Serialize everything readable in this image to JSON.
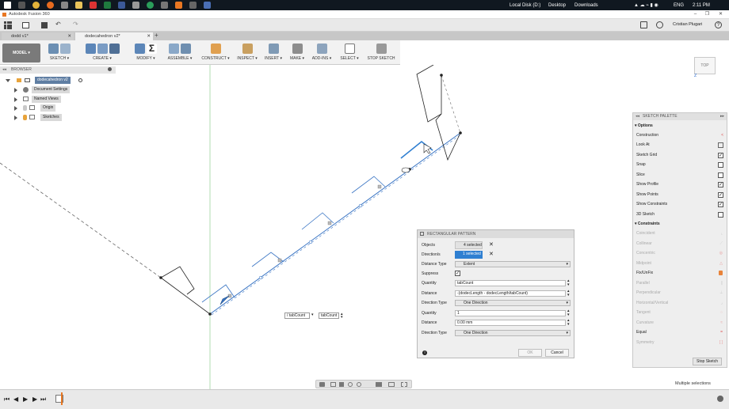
{
  "window": {
    "title": "Autodesk Fusion 360",
    "controls": [
      "–",
      "❐",
      "✕"
    ]
  },
  "taskbar": {
    "drive": "Local Disk (D:)",
    "desktop": "Desktop",
    "downloads": "Downloads",
    "lang": "ENG",
    "time": "2:11 PM"
  },
  "appbar": {
    "user": "Cristian Plugari"
  },
  "tabs": [
    {
      "label": "dodd v1*"
    },
    {
      "label": "dodecahedron v2*"
    }
  ],
  "toolbar": {
    "mode": "MODEL",
    "groups": [
      "SKETCH",
      "CREATE",
      "MODIFY",
      "ASSEMBLE",
      "CONSTRUCT",
      "INSPECT",
      "INSERT",
      "MAKE",
      "ADD-INS",
      "SELECT",
      "STOP SKETCH"
    ]
  },
  "browser": {
    "header": "BROWSER",
    "root": "dodecahedron v2",
    "items": [
      "Document Settings",
      "Named Views",
      "Origin",
      "Sketches"
    ]
  },
  "viewcube": {
    "face": "TOP",
    "axis": "Z"
  },
  "palette": {
    "title": "SKETCH PALETTE",
    "options_header": "Options",
    "options": [
      {
        "label": "Construction",
        "type": "icon",
        "icon": "construction-icon"
      },
      {
        "label": "Look At",
        "type": "icon",
        "icon": "look-at-icon"
      },
      {
        "label": "Sketch Grid",
        "type": "check",
        "checked": true
      },
      {
        "label": "Snap",
        "type": "check",
        "checked": false
      },
      {
        "label": "Slice",
        "type": "check",
        "checked": false
      },
      {
        "label": "Show Profile",
        "type": "check",
        "checked": true
      },
      {
        "label": "Show Points",
        "type": "check",
        "checked": true
      },
      {
        "label": "Show Constraints",
        "type": "check",
        "checked": true
      },
      {
        "label": "3D Sketch",
        "type": "check",
        "checked": false
      }
    ],
    "constraints_header": "Constraints",
    "constraints": [
      "Coincident",
      "Collinear",
      "Concentric",
      "Midpoint",
      "Fix/UnFix",
      "Parallel",
      "Perpendicular",
      "Horizontal/Vertical",
      "Tangent",
      "Curvature",
      "Equal",
      "Symmetry"
    ],
    "stop_button": "Stop Sketch",
    "status": "Multiple selections"
  },
  "dialog": {
    "title": "RECTANGULAR PATTERN",
    "objects_label": "Objects",
    "objects_value": "4 selected",
    "directions_label": "Direction/s",
    "directions_value": "1 selected",
    "distance_type_label": "Distance Type",
    "distance_type_value": "Extent",
    "suppress_label": "Suppress",
    "quantity1_label": "Quantity",
    "quantity1_value": "tabCount",
    "distance1_label": "Distance",
    "distance1_value": "-(dodecLength - dodecLength/tabCount)",
    "direction_type1_label": "Direction Type",
    "direction_type1_value": "One Direction",
    "quantity2_label": "Quantity",
    "quantity2_value": "1",
    "distance2_label": "Distance",
    "distance2_value": "0.00 mm",
    "direction_type2_label": "Direction Type",
    "direction_type2_value": "One Direction",
    "ok": "OK",
    "cancel": "Cancel",
    "info": "i"
  },
  "canvas_inputs": {
    "left": "/ tabCount",
    "right": "tabCount"
  },
  "colors": {
    "accent": "#2f7fd1",
    "selection": "#3a75c4",
    "toolbar": "#f2f2f2"
  }
}
